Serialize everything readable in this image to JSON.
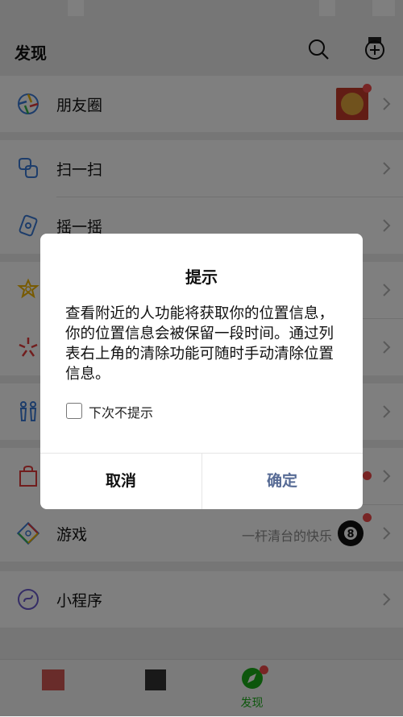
{
  "header": {
    "title": "发现"
  },
  "items": [
    {
      "label": "朋友圈"
    },
    {
      "label": "扫一扫"
    },
    {
      "label": "摇一摇"
    },
    {
      "label": ""
    },
    {
      "label": ""
    },
    {
      "label": ""
    },
    {
      "label": ""
    },
    {
      "label": "游戏",
      "sub": "一杆清台的快乐"
    },
    {
      "label": "小程序"
    }
  ],
  "tabbar": {
    "active_label": "发现"
  },
  "dialog": {
    "title": "提示",
    "message": "查看附近的人功能将获取你的位置信息，你的位置信息会被保留一段时间。通过列表右上角的清除功能可随时手动清除位置信息。",
    "checkbox_label": "下次不提示",
    "cancel": "取消",
    "confirm": "确定"
  },
  "colors": {
    "accent_green": "#1aad19",
    "confirm_blue": "#576b95",
    "badge_red": "#f04a4a"
  }
}
